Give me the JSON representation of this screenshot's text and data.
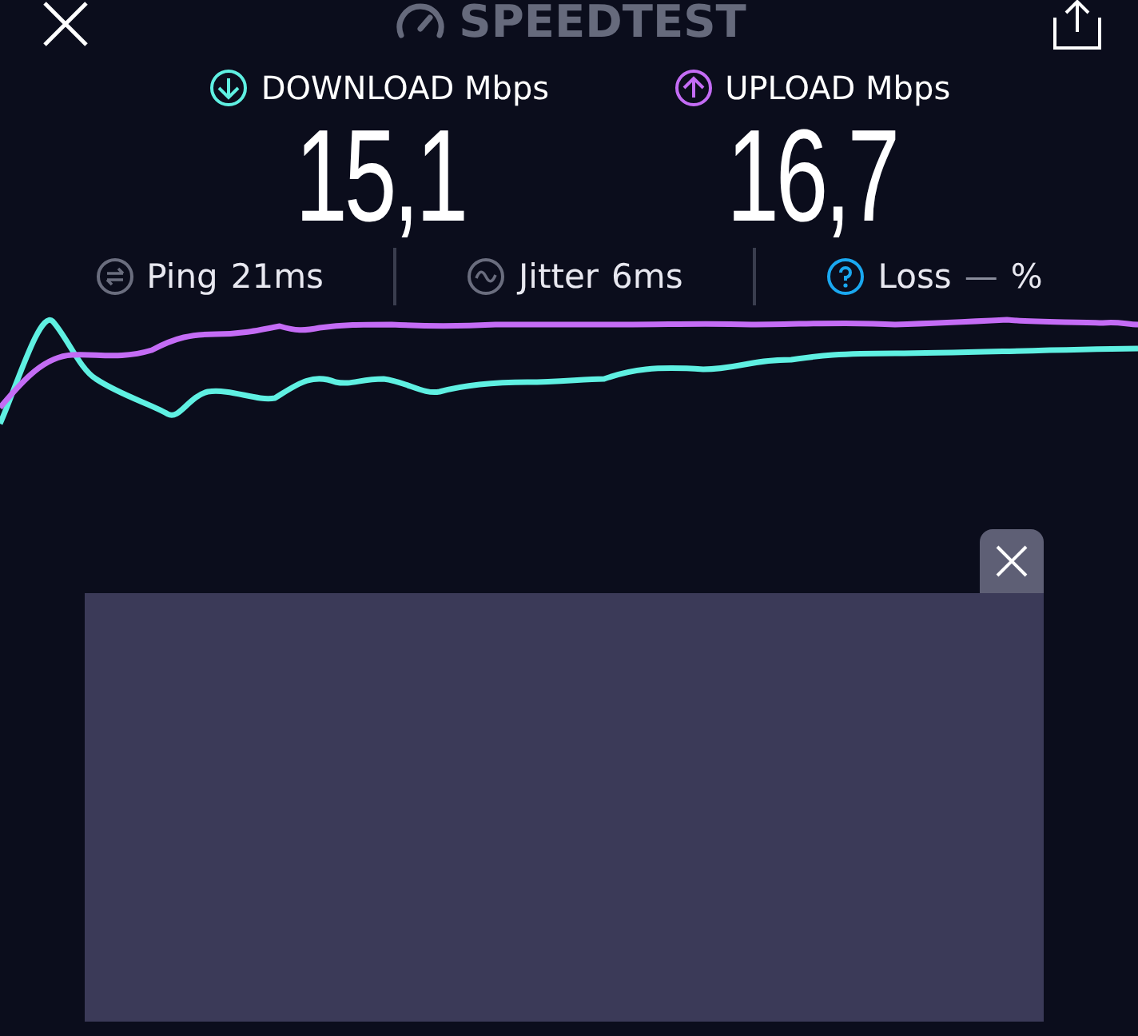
{
  "header": {
    "title": "SPEEDTEST"
  },
  "results": [
    {
      "kind": "download",
      "label": "DOWNLOAD",
      "unit": "Mbps",
      "value": "15,1",
      "color": "#5ff0e2"
    },
    {
      "kind": "upload",
      "label": "UPLOAD",
      "unit": "Mbps",
      "value": "16,7",
      "color": "#c46cf5"
    }
  ],
  "metrics": [
    {
      "kind": "ping",
      "label": "Ping",
      "value": "21ms"
    },
    {
      "kind": "jitter",
      "label": "Jitter",
      "value": "6ms"
    },
    {
      "kind": "loss",
      "label": "Loss",
      "value": "—",
      "unit": "%"
    }
  ]
}
